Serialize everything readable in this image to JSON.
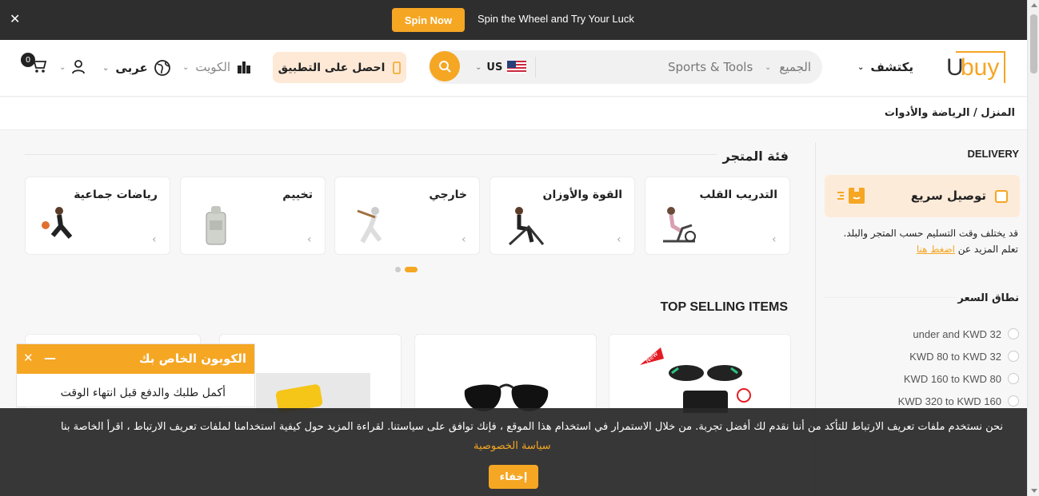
{
  "promo": {
    "close": "✕",
    "spin_button": "Spin Now",
    "text": "Spin the Wheel and Try Your Luck"
  },
  "header": {
    "logo_u": "U",
    "logo_buy": "buy",
    "discover": "يكتشف",
    "search_category": "الجميع",
    "search_value": "Sports & Tools",
    "country_code": "US",
    "app_button": "احصل على التطبيق",
    "region": "الكويت",
    "language": "عربى",
    "cart_count": "0"
  },
  "breadcrumb": "المنزل / الرياضة والأدوات",
  "sidebar": {
    "delivery_heading": "DELIVERY",
    "fast_delivery": "توصيل سريع",
    "note": "قد يختلف وقت التسليم حسب المتجر والبلد. تعلم المزيد عن",
    "note_link": "اضغط هنا",
    "price_heading": "نطاق السعر",
    "price_ranges": [
      "under and KWD 32",
      "KWD 80 to KWD 32",
      "KWD 160 to KWD 80",
      "KWD 320 to KWD 160"
    ]
  },
  "store_category": {
    "heading": "فئة المتجر",
    "cards": [
      "التدريب القلب",
      "القوة والأوزان",
      "خارجي",
      "تخييم",
      "رياضات جماعية"
    ]
  },
  "top_selling": {
    "heading": "TOP SELLING ITEMS"
  },
  "coupon": {
    "title": "الكوبون الخاص بك",
    "close": "✕",
    "minimize": "—",
    "body": "أكمل طلبك والدفع قبل انتهاء الوقت"
  },
  "cookie": {
    "text": "نحن نستخدم ملفات تعريف الارتباط للتأكد من أننا نقدم لك أفضل تجربة. من خلال الاستمرار في استخدام هذا الموقع ، فإنك توافق على سياستنا. لقراءة المزيد حول كيفية استخدامنا لملفات تعريف الارتباط ، اقرأ الخاصة بنا",
    "policy_link": "سياسة الخصوصية",
    "hide_button": "إخفاء"
  },
  "colors": {
    "accent": "#f5a623",
    "dark_bar": "#2e2e2e",
    "app_button_bg": "#fde9d6"
  }
}
